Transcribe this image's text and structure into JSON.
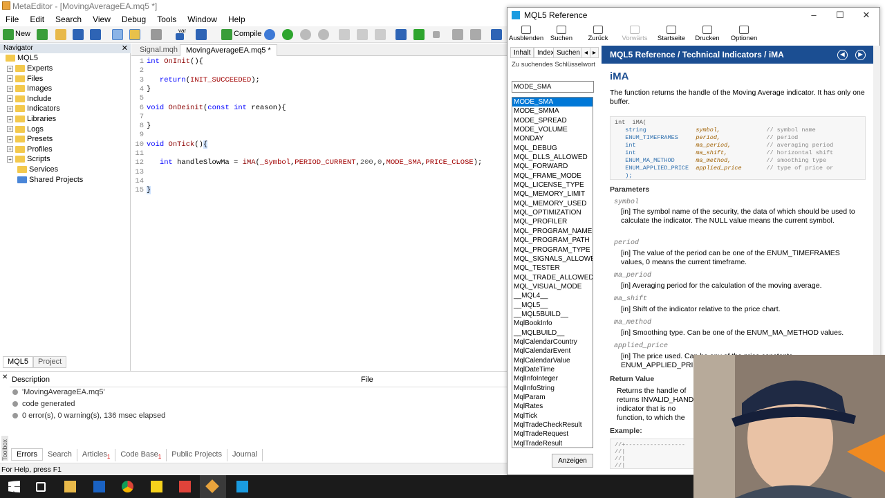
{
  "window_title": "MetaEditor - [MovingAverageEA.mq5 *]",
  "menu": [
    "File",
    "Edit",
    "Search",
    "View",
    "Debug",
    "Tools",
    "Window",
    "Help"
  ],
  "toolbar": {
    "new_label": "New",
    "compile_label": "Compile",
    "var_label": "var"
  },
  "navigator": {
    "title": "Navigator",
    "root": "MQL5",
    "items": [
      "Experts",
      "Files",
      "Images",
      "Include",
      "Indicators",
      "Libraries",
      "Logs",
      "Presets",
      "Profiles",
      "Scripts",
      "Services",
      "Shared Projects"
    ],
    "tabs": [
      "MQL5",
      "Project"
    ]
  },
  "editor": {
    "tabs": [
      "Signal.mqh",
      "MovingAverageEA.mq5 *"
    ],
    "line_numbers": [
      "1",
      "2",
      "3",
      "4",
      "5",
      "6",
      "7",
      "8",
      "9",
      "10",
      "11",
      "12",
      "13",
      "14",
      "15"
    ]
  },
  "bottom": {
    "col_description": "Description",
    "col_file": "File",
    "rows": [
      "'MovingAverageEA.mq5'",
      "code generated",
      "0 error(s), 0 warning(s), 136 msec elapsed"
    ],
    "side_label": "Toolbox",
    "tabs": [
      "Errors",
      "Search",
      "Articles",
      "Code Base",
      "Public Projects",
      "Journal"
    ],
    "articles_badge": "1",
    "codebase_badge": "1"
  },
  "status_text": "For Help, press F1",
  "help": {
    "title": "MQL5 Reference",
    "toolbar": [
      "Ausblenden",
      "Suchen",
      "Zurück",
      "Vorwärts",
      "Startseite",
      "Drucken",
      "Optionen"
    ],
    "left_tabs": [
      "Inhalt",
      "Index",
      "Suchen"
    ],
    "search_label": "Zu suchendes Schlüsselwort",
    "search_value": "MODE_SMA",
    "index_items": [
      "MODE_SMA",
      "MODE_SMMA",
      "MODE_SPREAD",
      "MODE_VOLUME",
      "MONDAY",
      "MQL_DEBUG",
      "MQL_DLLS_ALLOWED",
      "MQL_FORWARD",
      "MQL_FRAME_MODE",
      "MQL_LICENSE_TYPE",
      "MQL_MEMORY_LIMIT",
      "MQL_MEMORY_USED",
      "MQL_OPTIMIZATION",
      "MQL_PROFILER",
      "MQL_PROGRAM_NAME",
      "MQL_PROGRAM_PATH",
      "MQL_PROGRAM_TYPE",
      "MQL_SIGNALS_ALLOWE",
      "MQL_TESTER",
      "MQL_TRADE_ALLOWED",
      "MQL_VISUAL_MODE",
      "__MQL4__",
      "__MQL5__",
      "__MQL5BUILD__",
      "MqlBookInfo",
      "__MQLBUILD__",
      "MqlCalendarCountry",
      "MqlCalendarEvent",
      "MqlCalendarValue",
      "MqlDateTime",
      "MqlInfoInteger",
      "MqlInfoString",
      "MqlParam",
      "MqlRates",
      "MqlTick",
      "MqlTradeCheckResult",
      "MqlTradeRequest",
      "MqlTradeResult"
    ],
    "show_button": "Anzeigen",
    "breadcrumb": "MQL5 Reference / Technical Indicators / iMA",
    "heading": "iMA",
    "intro": "The function returns the handle of the Moving Average indicator. It has only one buffer.",
    "params_heading": "Parameters",
    "params": [
      {
        "name": "symbol",
        "desc": "[in] The symbol name of the security, the data of which should be used to calculate the indicator. The NULL value means the current symbol."
      },
      {
        "name": "period",
        "desc": "[in] The value of the period can be one of the ENUM_TIMEFRAMES values, 0 means the current timeframe."
      },
      {
        "name": "ma_period",
        "desc": "[in] Averaging period for the calculation of the moving average."
      },
      {
        "name": "ma_shift",
        "desc": "[in] Shift of the indicator relative to the price chart."
      },
      {
        "name": "ma_method",
        "desc": "[in] Smoothing type. Can be one of the ENUM_MA_METHOD values."
      },
      {
        "name": "applied_price",
        "desc": "[in] The price used. Can be any of the price constants ENUM_APPLIED_PRICE"
      }
    ],
    "return_heading": "Return Value",
    "return_lines": [
      "Returns the handle of",
      "returns INVALID_HAND",
      "indicator that is no",
      "function, to which the"
    ],
    "example_heading": "Example:"
  }
}
